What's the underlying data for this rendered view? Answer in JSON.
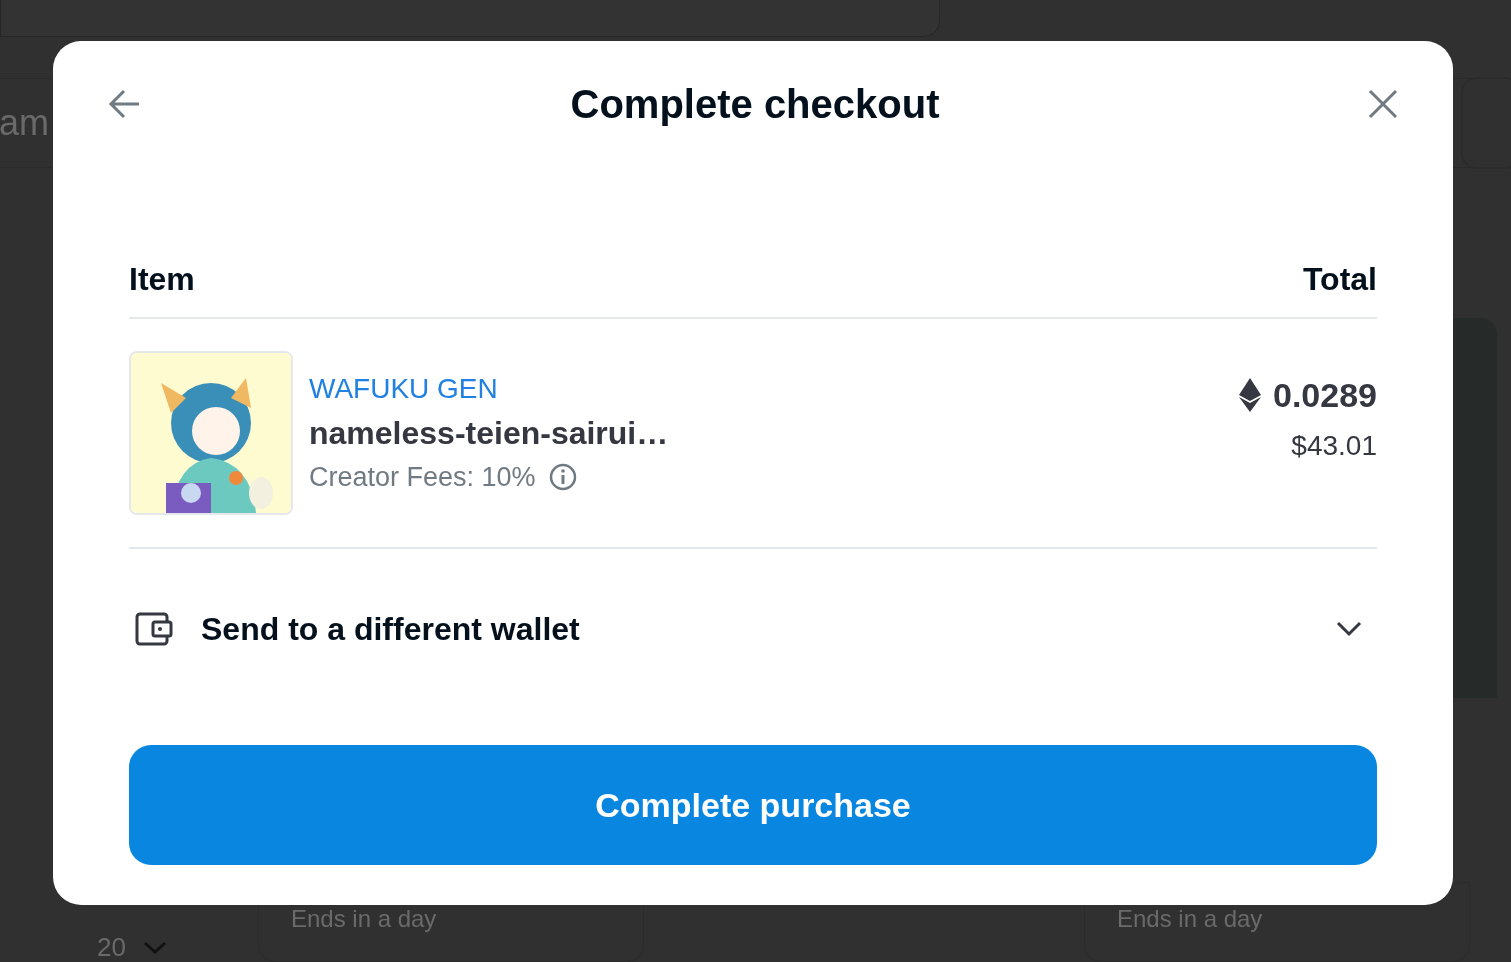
{
  "background": {
    "tab_fragment": "am",
    "page_size": "20",
    "cards": [
      {
        "time_left": "Ends in a day"
      },
      {
        "time_left": "Ends in a day"
      }
    ]
  },
  "dialog": {
    "title": "Complete checkout",
    "columns": [
      "Item",
      "Total"
    ],
    "item": {
      "kind": "picture",
      "collection": "WAFUKU GEN",
      "name": "nameless-teien-sairui…",
      "fees": "Creator Fees: 10%",
      "price": "0.0289",
      "price_usd": "$43.01"
    },
    "wallet_option": {
      "label": "Send to a different wallet",
      "expanded": false
    },
    "primary_button": "Complete purchase"
  }
}
